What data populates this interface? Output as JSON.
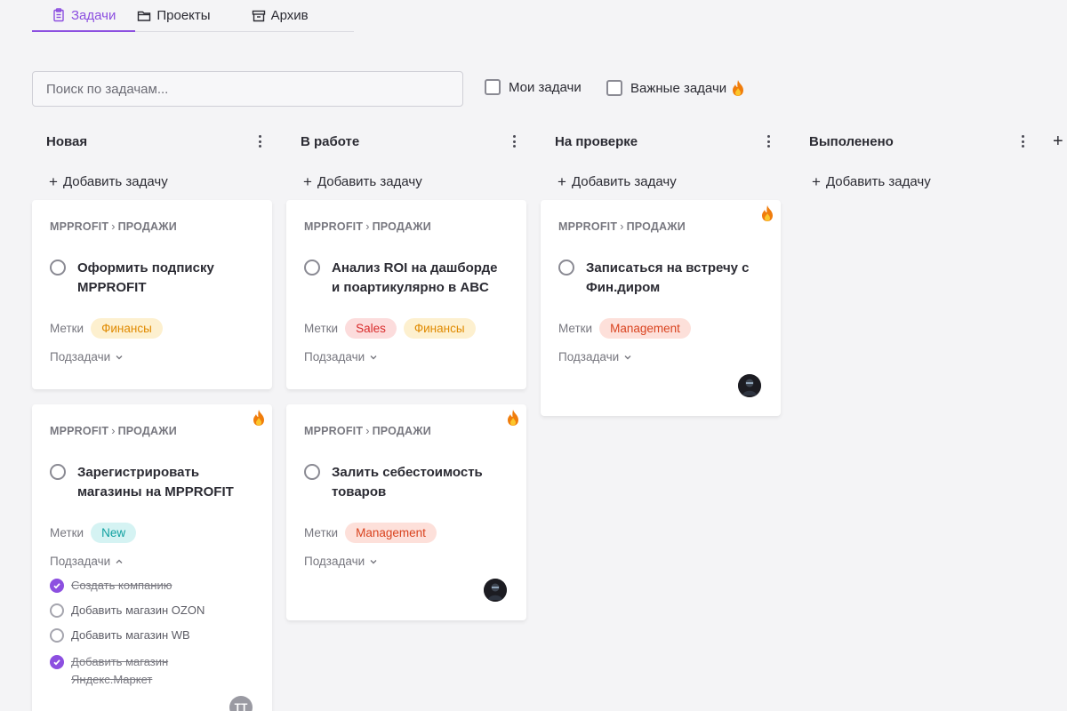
{
  "tabs": [
    {
      "label": "Задачи",
      "icon": "clipboard-icon",
      "active": true
    },
    {
      "label": "Проекты",
      "icon": "folder-icon",
      "active": false
    },
    {
      "label": "Архив",
      "icon": "archive-icon",
      "active": false
    }
  ],
  "search": {
    "placeholder": "Поиск по задачам...",
    "value": ""
  },
  "filters": {
    "my_tasks": {
      "label": "Мои задачи",
      "checked": false
    },
    "important_tasks": {
      "label": "Важные задачи",
      "checked": false,
      "icon": "fire-icon"
    }
  },
  "columns": [
    {
      "title": "Новая",
      "add_label": "Добавить задачу"
    },
    {
      "title": "В работе",
      "add_label": "Добавить задачу"
    },
    {
      "title": "На проверке",
      "add_label": "Добавить задачу"
    },
    {
      "title": "Выполенено",
      "add_label": "Добавить задачу"
    }
  ],
  "add_column_icon": "plus-icon",
  "common": {
    "project": "MPPROFIT",
    "section": "ПРОДАЖИ",
    "labels_caption": "Метки",
    "subtasks_caption": "Подзадачи"
  },
  "cards": {
    "c1": {
      "title": "Оформить подписку MPPROFIT",
      "tags": [
        "Финансы"
      ],
      "important": false
    },
    "c2": {
      "title": "Зарегистрировать магазины на MPPROFIT",
      "tags": [
        "New"
      ],
      "important": true,
      "assignee_initials": "TT",
      "subtasks_expanded": true,
      "subtasks": [
        {
          "label": "Создать компанию",
          "done": true
        },
        {
          "label": "Добавить магазин OZON",
          "done": false
        },
        {
          "label": "Добавить магазин WB",
          "done": false
        },
        {
          "label": "Добавить магазин Яндекс.Маркет",
          "done": true
        }
      ]
    },
    "c3": {
      "title": "Анализ ROI на дашборде и поартикулярно в ABC",
      "tags": [
        "Sales",
        "Финансы"
      ],
      "important": false
    },
    "c4": {
      "title": "Залить себестоимость товаров",
      "tags": [
        "Management"
      ],
      "important": true,
      "has_avatar": true
    },
    "c5": {
      "title": "Записаться на встречу с Фин.диром",
      "tags": [
        "Management"
      ],
      "important": true,
      "has_avatar": true
    }
  },
  "colors": {
    "accent": "#8c4fe0",
    "tag_finance": "#e08a00",
    "tag_sales": "#d92b2b",
    "tag_management": "#d9431f",
    "tag_new": "#10a0a0"
  }
}
